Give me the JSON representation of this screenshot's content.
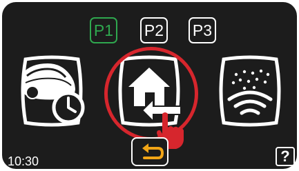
{
  "programs": [
    {
      "label": "P1",
      "active": true
    },
    {
      "label": "P2",
      "active": false
    },
    {
      "label": "P3",
      "active": false
    }
  ],
  "tiles": [
    {
      "icon": "mower-schedule-icon",
      "action": "schedule"
    },
    {
      "icon": "park-home-icon",
      "action": "park",
      "highlighted": true
    },
    {
      "icon": "rain-sensor-icon",
      "action": "weather"
    }
  ],
  "status": {
    "time": "10:30"
  },
  "footer": {
    "back_icon": "back-arrow-icon",
    "help_label": "?"
  },
  "colors": {
    "background": "#1c1c1c",
    "foreground": "#ffffff",
    "active_program": "#2fa84f",
    "highlight": "#d6262d",
    "back_arrow": "#f2a516"
  }
}
